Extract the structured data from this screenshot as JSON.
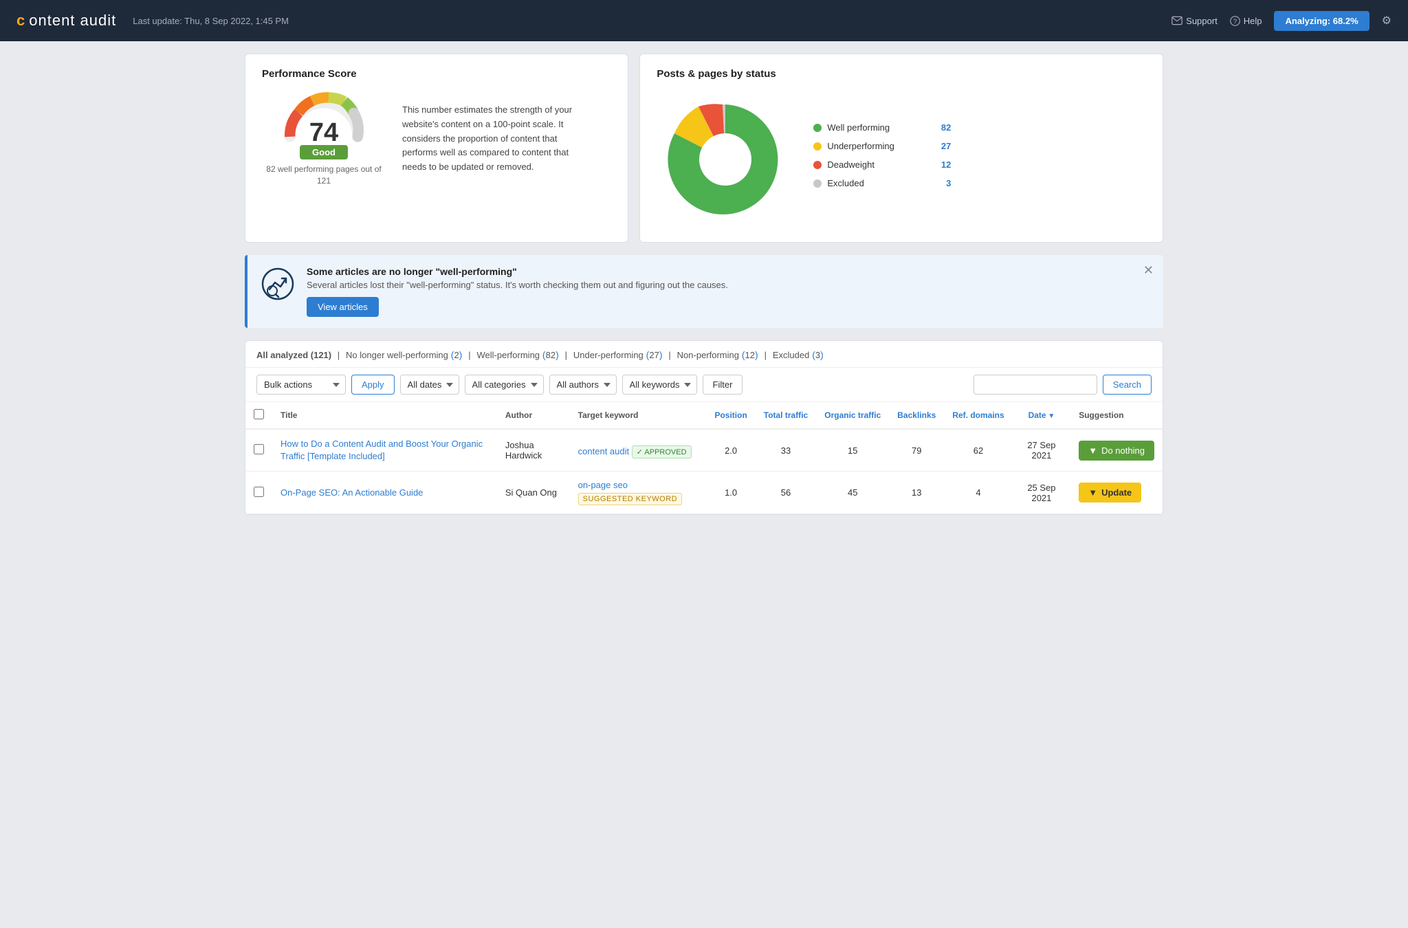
{
  "header": {
    "logo_icon": "c",
    "logo_text": "ontent audit",
    "last_update": "Last update: Thu, 8 Sep 2022, 1:45 PM",
    "support_label": "Support",
    "help_label": "Help",
    "analyzing_label": "Analyzing: 68.2%",
    "gear_label": "⚙"
  },
  "performance_score": {
    "title": "Performance Score",
    "score": "74",
    "label": "Good",
    "sub": "82 well performing pages\nout of 121",
    "description": "This number estimates the strength of your website's content on a 100-point scale. It considers the proportion of content that performs well as compared to content that needs to be updated or removed."
  },
  "posts_by_status": {
    "title": "Posts & pages by status",
    "legend": [
      {
        "label": "Well performing",
        "count": "82",
        "color": "#4caf50"
      },
      {
        "label": "Underperforming",
        "count": "27",
        "color": "#f5c518"
      },
      {
        "label": "Deadweight",
        "count": "12",
        "color": "#e8533a"
      },
      {
        "label": "Excluded",
        "count": "3",
        "color": "#c8c8c8"
      }
    ]
  },
  "alert": {
    "title": "Some articles are no longer \"well-performing\"",
    "description": "Several articles lost their \"well-performing\" status. It's worth checking them out and figuring out the causes.",
    "button_label": "View articles",
    "close_label": "✕"
  },
  "tabs": {
    "all_analyzed": "All analyzed",
    "all_analyzed_count": "121",
    "no_longer": "No longer well-performing",
    "no_longer_count": "2",
    "well_performing": "Well-performing",
    "well_performing_count": "82",
    "under_performing": "Under-performing",
    "under_performing_count": "27",
    "non_performing": "Non-performing",
    "non_performing_count": "12",
    "excluded": "Excluded",
    "excluded_count": "3"
  },
  "filters": {
    "bulk_actions": "Bulk actions",
    "apply": "Apply",
    "all_dates": "All dates",
    "all_categories": "All categories",
    "all_authors": "All authors",
    "all_keywords": "All keywords",
    "filter": "Filter",
    "search_placeholder": "",
    "search_btn": "Search"
  },
  "table": {
    "columns": [
      "",
      "Title",
      "Author",
      "Target keyword",
      "Position",
      "Total traffic",
      "Organic traffic",
      "Backlinks",
      "Ref. domains",
      "Date",
      "Suggestion"
    ],
    "rows": [
      {
        "title": "How to Do a Content Audit and Boost Your Organic Traffic [Template Included]",
        "author": "Joshua Hardwick",
        "keyword": "content audit",
        "keyword_badge": "APPROVED",
        "position": "2.0",
        "total_traffic": "33",
        "organic_traffic": "15",
        "backlinks": "79",
        "ref_domains": "62",
        "date": "27 Sep 2021",
        "suggestion": "Do nothing",
        "suggestion_type": "green"
      },
      {
        "title": "On-Page SEO: An Actionable Guide",
        "author": "Si Quan Ong",
        "keyword": "on-page seo",
        "keyword_badge": "SUGGESTED KEYWORD",
        "position": "1.0",
        "total_traffic": "56",
        "organic_traffic": "45",
        "backlinks": "13",
        "ref_domains": "4",
        "date": "25 Sep 2021",
        "suggestion": "Update",
        "suggestion_type": "yellow"
      }
    ]
  }
}
